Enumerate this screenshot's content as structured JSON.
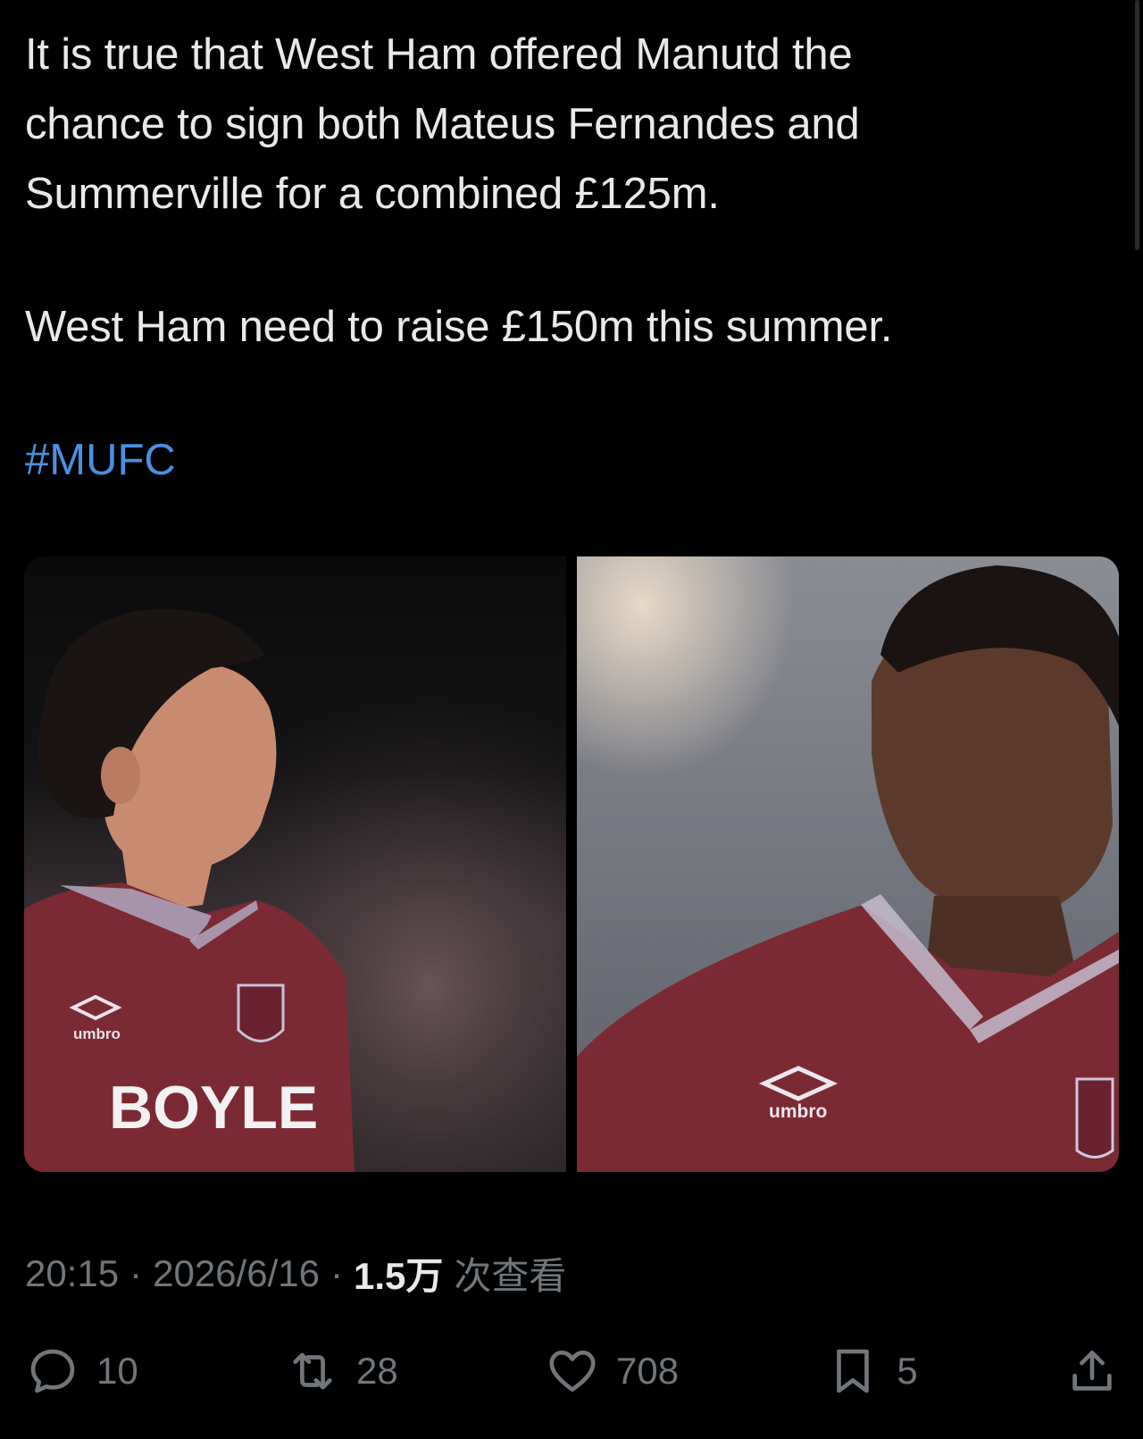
{
  "tweet": {
    "text_lines": [
      "It is true that West Ham offered Manutd the",
      "chance to sign both Mateus Fernandes and",
      "Summerville for a combined £125m."
    ],
    "text_para2": "West Ham need to raise £150m this summer.",
    "hashtag": "#MUFC"
  },
  "media": {
    "left_shirt_brand": "umbro",
    "left_sponsor": "BOYLE",
    "right_shirt_brand": "umbro"
  },
  "meta": {
    "time": "20:15",
    "date": "2026/6/16",
    "views_count": "1.5万",
    "views_label": "次查看",
    "separator": "·"
  },
  "actions": {
    "replies": "10",
    "retweets": "28",
    "likes": "708",
    "bookmarks": "5"
  },
  "icons": {
    "reply": "reply-icon",
    "retweet": "retweet-icon",
    "like": "heart-icon",
    "bookmark": "bookmark-icon",
    "share": "share-icon"
  }
}
